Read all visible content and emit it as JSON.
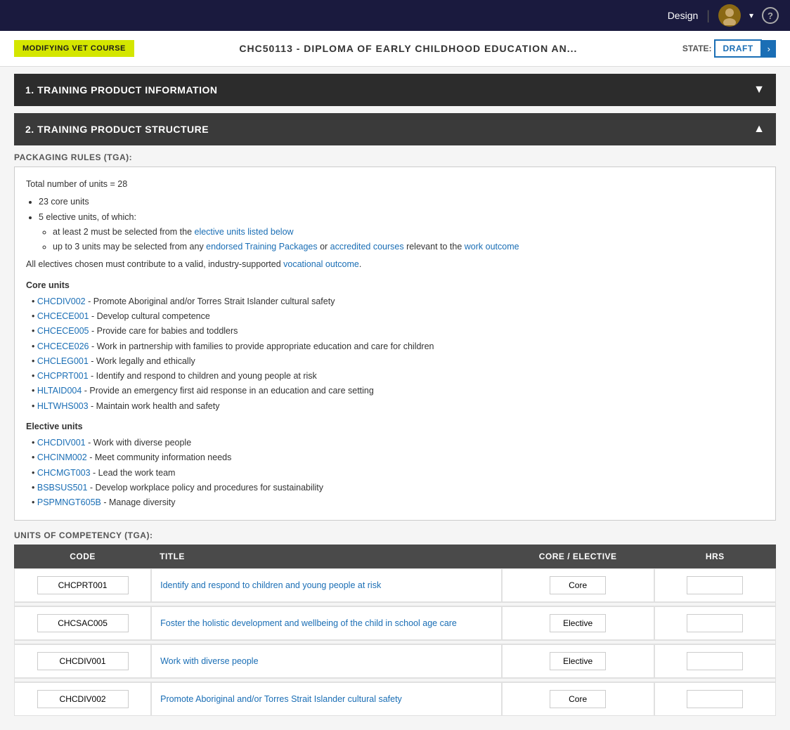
{
  "topNav": {
    "design_label": "Design",
    "help_label": "?"
  },
  "header": {
    "badge_label": "MODIFYING VET COURSE",
    "course_title": "CHC50113 - DIPLOMA OF EARLY CHILDHOOD EDUCATION AN...",
    "state_label": "STATE:",
    "state_value": "DRAFT"
  },
  "sections": {
    "section1_label": "1. TRAINING PRODUCT INFORMATION",
    "section2_label": "2. TRAINING PRODUCT STRUCTURE"
  },
  "packagingRules": {
    "label": "PACKAGING RULES (TGA):",
    "total_units": "Total number of units = 28",
    "bullet1": "23 core units",
    "bullet2": "5 elective units, of which:",
    "sub_bullet1": "at least 2 must be selected from the elective units listed below",
    "sub_bullet2": "up to 3 units may be selected from any endorsed Training Packages or accredited courses relevant to the work outcome",
    "note": "All electives chosen must contribute to a valid, industry-supported vocational outcome.",
    "core_units_label": "Core units",
    "core_units": [
      "CHCDIV002  - Promote Aboriginal and/or Torres Strait Islander cultural safety",
      "CHCECE001  - Develop cultural competence",
      "CHCECE005  - Provide care for babies and toddlers",
      "CHCECE026  - Work in partnership with families to provide appropriate education and care for children",
      "CHCLEG001  - Work legally and ethically",
      "CHCPRT001  - Identify and respond to children and young people at risk",
      "HLTAID004  - Provide an emergency first aid response in an education and care setting",
      "HLTWHS003  - Maintain work health and safety"
    ],
    "elective_units_label": "Elective units",
    "elective_units": [
      "CHCDIV001  - Work with diverse people",
      "CHCINM002  - Meet community information needs",
      "CHCMGT003  - Lead the work team",
      "BSBSUS501  - Develop workplace policy and procedures for sustainability",
      "PSPMNGT605B  - Manage diversity"
    ]
  },
  "uocTable": {
    "label": "UNITS OF COMPETENCY (TGA):",
    "columns": [
      "CODE",
      "TITLE",
      "CORE / ELECTIVE",
      "HRS"
    ],
    "rows": [
      {
        "code": "CHCPRT001",
        "title": "Identify and respond to children and young people at risk",
        "core_elective": "Core",
        "hrs": ""
      },
      {
        "code": "CHCSAC005",
        "title": "Foster the holistic development and wellbeing of the child in school age care",
        "core_elective": "Elective",
        "hrs": ""
      },
      {
        "code": "CHCDIV001",
        "title": "Work with diverse people",
        "core_elective": "Elective",
        "hrs": ""
      },
      {
        "code": "CHCDIV002",
        "title": "Promote Aboriginal and/or Torres Strait Islander cultural safety",
        "core_elective": "Core",
        "hrs": ""
      }
    ]
  }
}
